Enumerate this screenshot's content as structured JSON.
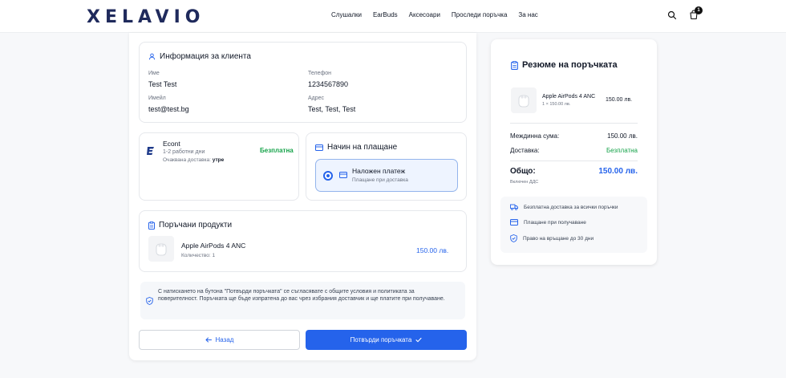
{
  "header": {
    "logo": "XELAVIO",
    "nav": [
      "Слушалки",
      "EarBuds",
      "Аксесоари",
      "Проследи поръчка",
      "За нас"
    ],
    "cart_count": "1"
  },
  "customer": {
    "title": "Информация за клиента",
    "name_label": "Име",
    "name": "Test Test",
    "phone_label": "Телефон",
    "phone": "1234567890",
    "email_label": "Имейл",
    "email": "test@test.bg",
    "address_label": "Адрес",
    "address": "Test, Test, Test"
  },
  "shipping": {
    "carrier": "Econt",
    "days": "1-2 работни дни",
    "expected_label": "Очаквана доставка:",
    "expected_value": "утре",
    "price": "Безплатна"
  },
  "payment": {
    "title": "Начин на плащане",
    "option_title": "Наложен платеж",
    "option_sub": "Плащане при доставка"
  },
  "products": {
    "title": "Поръчани продукти",
    "items": [
      {
        "name": "Apple AirPods 4 ANC",
        "qty": "Количество: 1",
        "price": "150.00 лв."
      }
    ]
  },
  "consent": "С натискането на бутона \"Потвърди поръчката\" се съгласявате с общите условия и политиката за поверителност. Поръчката ще бъде изпратена до вас чрез избрания доставчик и ще платите при получаване.",
  "buttons": {
    "back": "Назад",
    "confirm": "Потвърди поръчката"
  },
  "summary": {
    "title": "Резюме на поръчката",
    "item_name": "Apple AirPods 4 ANC",
    "item_qty": "1 × 150.00 лв.",
    "item_price": "150.00 лв.",
    "subtotal_label": "Междинна сума:",
    "subtotal": "150.00 лв.",
    "delivery_label": "Доставка:",
    "delivery": "Безплатна",
    "total_label": "Общо:",
    "total": "150.00 лв.",
    "vat_note": "Включен ДДС",
    "benefits": [
      "Безплатна доставка за всички поръчки",
      "Плащане при получаване",
      "Право на връщане до 30 дни"
    ]
  },
  "colors": {
    "accent": "#2563eb",
    "success": "#16a34a",
    "logo": "#1f2a5c"
  }
}
